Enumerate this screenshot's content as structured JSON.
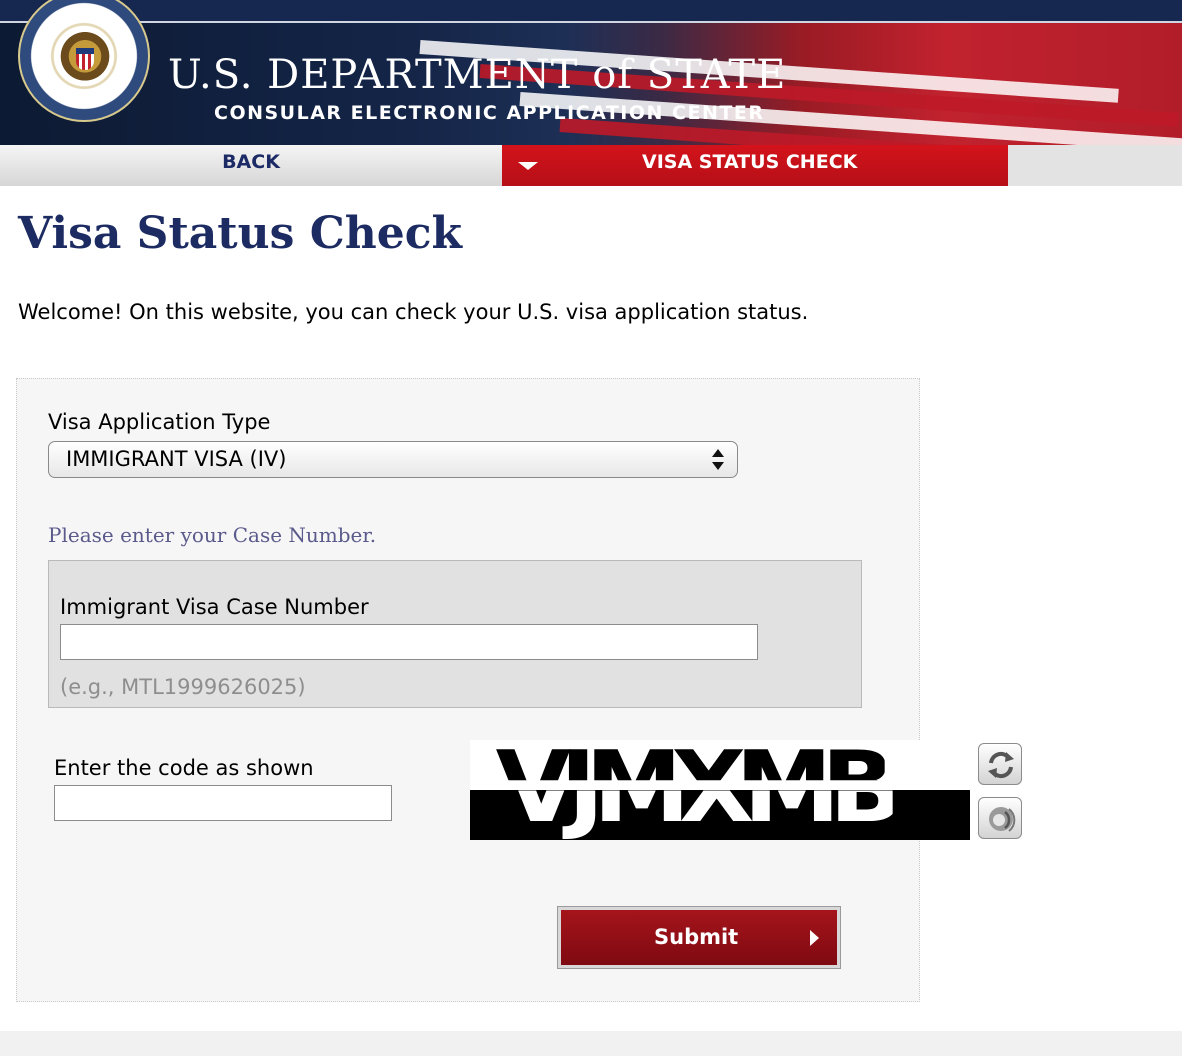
{
  "header": {
    "department_title": "U.S. DEPARTMENT of STATE",
    "subtitle": "CONSULAR ELECTRONIC APPLICATION CENTER",
    "seal_icon": "department-of-state-seal",
    "colors": {
      "navy": "#16284f",
      "red": "#c1222e"
    }
  },
  "nav": {
    "back_label": "BACK",
    "active_label": "VISA STATUS CHECK",
    "active_icon": "caret-down-icon",
    "active_color": "#d4131b"
  },
  "main": {
    "title": "Visa Status Check",
    "welcome": "Welcome! On this website, you can check your U.S. visa application status."
  },
  "form": {
    "application_type_label": "Visa Application Type",
    "application_type_value": "IMMIGRANT VISA (IV)",
    "case_prompt": "Please enter your Case Number.",
    "case_label": "Immigrant Visa Case Number",
    "case_value": "",
    "case_example": "(e.g., MTL1999626025)",
    "code_label": "Enter the code as shown",
    "code_value": "",
    "captcha_top_text": "VJMXMB",
    "captcha_bottom_text": "VJMXMB",
    "refresh_icon": "refresh-icon",
    "audio_icon": "audio-icon",
    "submit_label": "Submit",
    "submit_color": "#a5141b"
  }
}
